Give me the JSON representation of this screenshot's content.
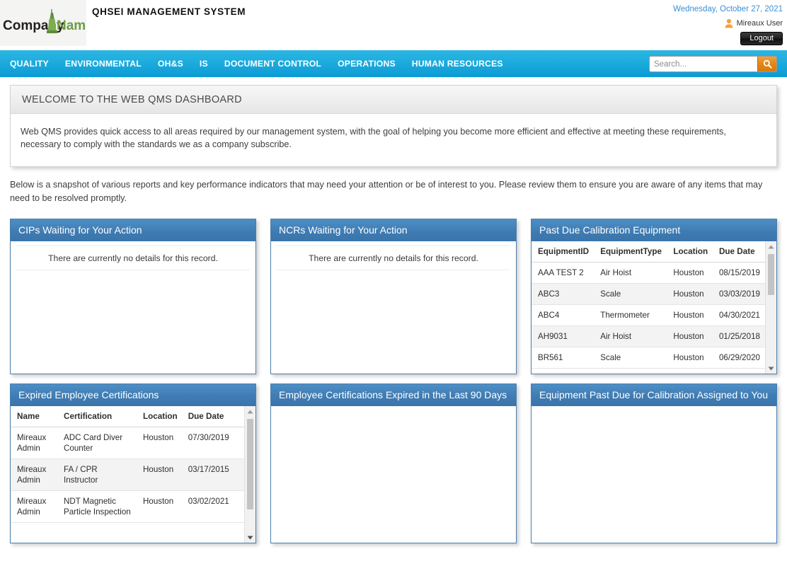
{
  "header": {
    "logo_company": "Company",
    "logo_name": "Name",
    "app_title": "QHSEI MANAGEMENT SYSTEM",
    "date": "Wednesday, October 27, 2021",
    "user_name": "Mireaux User",
    "logout_label": "Logout"
  },
  "nav": {
    "items": [
      {
        "label": "QUALITY"
      },
      {
        "label": "ENVIRONMENTAL"
      },
      {
        "label": "OH&S"
      },
      {
        "label": "IS"
      },
      {
        "label": "DOCUMENT CONTROL"
      },
      {
        "label": "OPERATIONS"
      },
      {
        "label": "HUMAN RESOURCES"
      }
    ],
    "search_placeholder": "Search..."
  },
  "welcome": {
    "title": "WELCOME TO THE WEB QMS DASHBOARD",
    "body": "Web QMS provides quick access to all areas required by our management system, with the goal of helping you become more efficient and effective at meeting these requirements, necessary to comply with the standards we as a company subscribe."
  },
  "intro": "Below is a snapshot of various reports and key performance indicators that may need your attention or be of interest to you. Please review them to ensure you are aware of any items that may need to be resolved promptly.",
  "empty_message": "There are currently no details for this record.",
  "cards": {
    "cips": {
      "title": "CIPs Waiting for Your Action"
    },
    "ncrs": {
      "title": "NCRs Waiting for Your Action"
    },
    "calibration": {
      "title": "Past Due Calibration Equipment",
      "columns": [
        "EquipmentID",
        "EquipmentType",
        "Location",
        "Due Date"
      ],
      "rows": [
        [
          "AAA TEST 2",
          "Air Hoist",
          "Houston",
          "08/15/2019"
        ],
        [
          "ABC3",
          "Scale",
          "Houston",
          "03/03/2019"
        ],
        [
          "ABC4",
          "Thermometer",
          "Houston",
          "04/30/2021"
        ],
        [
          "AH9031",
          "Air Hoist",
          "Houston",
          "01/25/2018"
        ],
        [
          "BR561",
          "Scale",
          "Houston",
          "06/29/2020"
        ]
      ]
    },
    "expired_certs": {
      "title": "Expired Employee Certifications",
      "columns": [
        "Name",
        "Certification",
        "Location",
        "Due Date"
      ],
      "rows": [
        [
          "Mireaux Admin",
          "ADC Card Diver Counter",
          "Houston",
          "07/30/2019"
        ],
        [
          "Mireaux Admin",
          "FA / CPR Instructor",
          "Houston",
          "03/17/2015"
        ],
        [
          "Mireaux Admin",
          "NDT Magnetic Particle Inspection",
          "Houston",
          "03/02/2021"
        ]
      ]
    },
    "certs_90days": {
      "title": "Employee Certifications Expired in the Last 90 Days"
    },
    "equipment_assigned": {
      "title": "Equipment Past Due for Calibration Assigned to You"
    }
  },
  "colors": {
    "nav_blue": "#0c9ad4",
    "card_header_blue": "#3f7cb3",
    "date_blue": "#3b8fd4",
    "search_orange": "#e2861a"
  }
}
